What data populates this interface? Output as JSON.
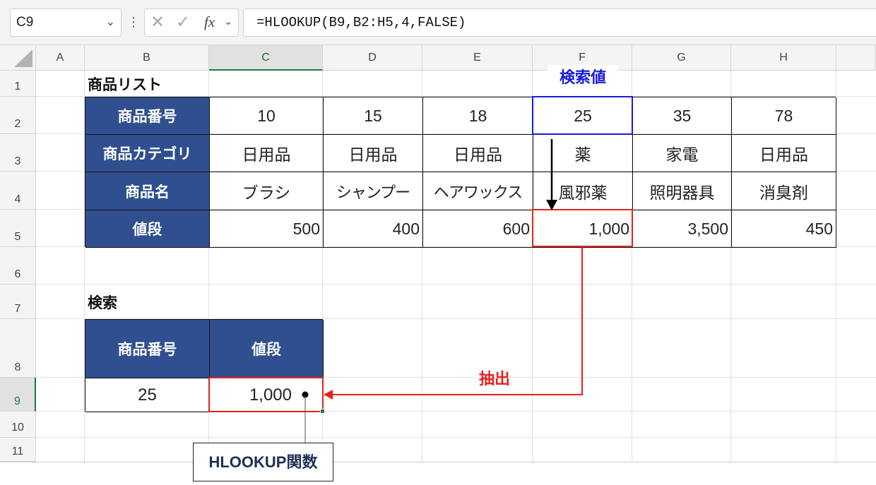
{
  "formula_bar": {
    "name_box": "C9",
    "fx_label": "fx",
    "formula": "=HLOOKUP(B9,B2:H5,4,FALSE)"
  },
  "columns": [
    "A",
    "B",
    "C",
    "D",
    "E",
    "F",
    "G",
    "H"
  ],
  "rows": [
    "1",
    "2",
    "3",
    "4",
    "5",
    "6",
    "7",
    "8",
    "9",
    "10",
    "11"
  ],
  "sheet": {
    "list_title": "商品リスト",
    "table_headers": [
      "商品番号",
      "商品カテゴリ",
      "商品名",
      "値段"
    ],
    "product_numbers": [
      "10",
      "15",
      "18",
      "25",
      "35",
      "78"
    ],
    "categories": [
      "日用品",
      "日用品",
      "日用品",
      "薬",
      "家電",
      "日用品"
    ],
    "names": [
      "ブラシ",
      "シャンプー",
      "ヘアワックス",
      "風邪薬",
      "照明器具",
      "消臭剤"
    ],
    "prices": [
      "500",
      "400",
      "600",
      "1,000",
      "3,500",
      "450"
    ],
    "search_title": "検索",
    "search_headers": [
      "商品番号",
      "値段"
    ],
    "search_values": [
      "25",
      "1,000"
    ]
  },
  "annotations": {
    "lookup_value_label": "検索値",
    "extract_label": "抽出",
    "function_label": "HLOOKUP関数",
    "lookup_color": "#1a1adf",
    "extract_color": "#e8211e"
  },
  "colors": {
    "header_fill": "#2f4f8f",
    "selected_column": "#1d7a45"
  }
}
